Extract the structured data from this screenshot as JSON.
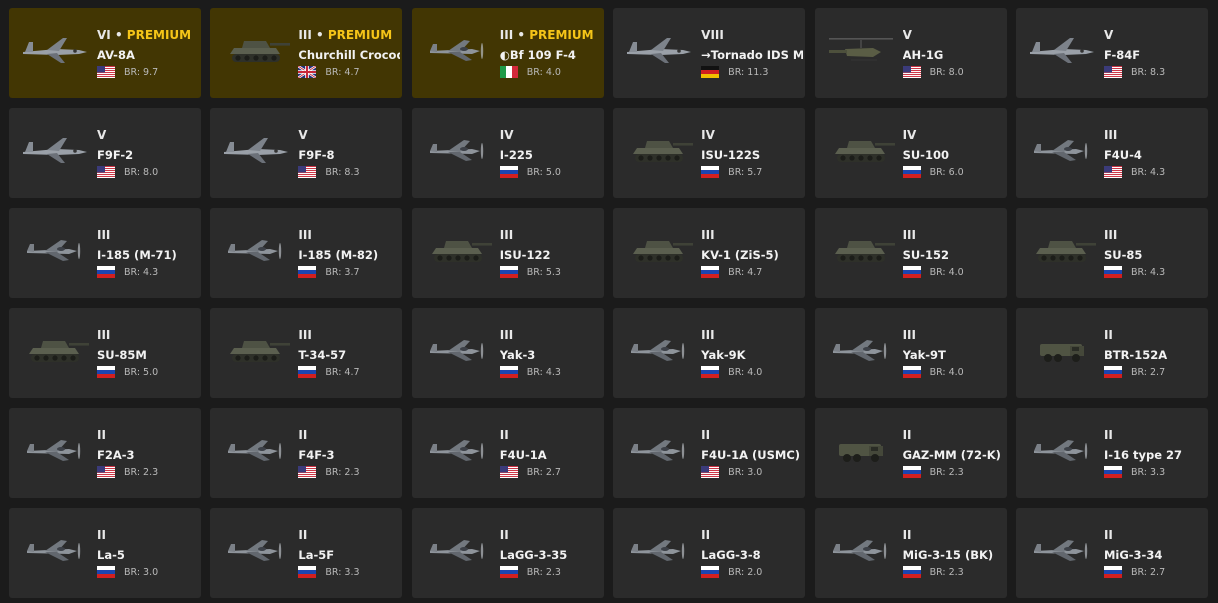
{
  "colors": {
    "background": "#1b1b1b",
    "card": "#2b2b2b",
    "premium_card": "#423603",
    "premium_text": "#f5c518"
  },
  "vehicles": [
    {
      "rank": "VI",
      "premium": true,
      "premium_label": "PREMIUM",
      "name": "AV-8A",
      "flag": "usa",
      "br": "BR: 9.7",
      "type": "jet"
    },
    {
      "rank": "III",
      "premium": true,
      "premium_label": "PREMIUM",
      "name": "Churchill Crocodile",
      "flag": "uk",
      "br": "BR: 4.7",
      "type": "tank"
    },
    {
      "rank": "III",
      "premium": true,
      "premium_label": "PREMIUM",
      "name": "◐Bf 109 F-4",
      "flag": "italy",
      "br": "BR: 4.0",
      "type": "prop"
    },
    {
      "rank": "VIII",
      "premium": false,
      "name": "→Tornado IDS MFG",
      "flag": "germany",
      "br": "BR: 11.3",
      "type": "jet"
    },
    {
      "rank": "V",
      "premium": false,
      "name": "AH-1G",
      "flag": "usa",
      "br": "BR: 8.0",
      "type": "heli"
    },
    {
      "rank": "V",
      "premium": false,
      "name": "F-84F",
      "flag": "usa",
      "br": "BR: 8.3",
      "type": "jet"
    },
    {
      "rank": "V",
      "premium": false,
      "name": "F9F-2",
      "flag": "usa",
      "br": "BR: 8.0",
      "type": "jet"
    },
    {
      "rank": "V",
      "premium": false,
      "name": "F9F-8",
      "flag": "usa",
      "br": "BR: 8.3",
      "type": "jet"
    },
    {
      "rank": "IV",
      "premium": false,
      "name": "I-225",
      "flag": "russia",
      "br": "BR: 5.0",
      "type": "prop"
    },
    {
      "rank": "IV",
      "premium": false,
      "name": "ISU-122S",
      "flag": "russia",
      "br": "BR: 5.7",
      "type": "tank"
    },
    {
      "rank": "IV",
      "premium": false,
      "name": "SU-100",
      "flag": "russia",
      "br": "BR: 6.0",
      "type": "tank"
    },
    {
      "rank": "III",
      "premium": false,
      "name": "F4U-4",
      "flag": "usa",
      "br": "BR: 4.3",
      "type": "prop"
    },
    {
      "rank": "III",
      "premium": false,
      "name": "I-185 (M-71)",
      "flag": "russia",
      "br": "BR: 4.3",
      "type": "prop"
    },
    {
      "rank": "III",
      "premium": false,
      "name": "I-185 (M-82)",
      "flag": "russia",
      "br": "BR: 3.7",
      "type": "prop"
    },
    {
      "rank": "III",
      "premium": false,
      "name": "ISU-122",
      "flag": "russia",
      "br": "BR: 5.3",
      "type": "tank"
    },
    {
      "rank": "III",
      "premium": false,
      "name": "KV-1 (ZiS-5)",
      "flag": "russia",
      "br": "BR: 4.7",
      "type": "tank"
    },
    {
      "rank": "III",
      "premium": false,
      "name": "SU-152",
      "flag": "russia",
      "br": "BR: 4.0",
      "type": "tank"
    },
    {
      "rank": "III",
      "premium": false,
      "name": "SU-85",
      "flag": "russia",
      "br": "BR: 4.3",
      "type": "tank"
    },
    {
      "rank": "III",
      "premium": false,
      "name": "SU-85M",
      "flag": "russia",
      "br": "BR: 5.0",
      "type": "tank"
    },
    {
      "rank": "III",
      "premium": false,
      "name": "T-34-57",
      "flag": "russia",
      "br": "BR: 4.7",
      "type": "tank"
    },
    {
      "rank": "III",
      "premium": false,
      "name": "Yak-3",
      "flag": "russia",
      "br": "BR: 4.3",
      "type": "prop"
    },
    {
      "rank": "III",
      "premium": false,
      "name": "Yak-9K",
      "flag": "russia",
      "br": "BR: 4.0",
      "type": "prop"
    },
    {
      "rank": "III",
      "premium": false,
      "name": "Yak-9T",
      "flag": "russia",
      "br": "BR: 4.0",
      "type": "prop"
    },
    {
      "rank": "II",
      "premium": false,
      "name": "BTR-152A",
      "flag": "russia",
      "br": "BR: 2.7",
      "type": "truck"
    },
    {
      "rank": "II",
      "premium": false,
      "name": "F2A-3",
      "flag": "usa",
      "br": "BR: 2.3",
      "type": "prop"
    },
    {
      "rank": "II",
      "premium": false,
      "name": "F4F-3",
      "flag": "usa",
      "br": "BR: 2.3",
      "type": "prop"
    },
    {
      "rank": "II",
      "premium": false,
      "name": "F4U-1A",
      "flag": "usa",
      "br": "BR: 2.7",
      "type": "prop"
    },
    {
      "rank": "II",
      "premium": false,
      "name": "F4U-1A (USMC)",
      "flag": "usa",
      "br": "BR: 3.0",
      "type": "prop"
    },
    {
      "rank": "II",
      "premium": false,
      "name": "GAZ-MM (72-K)",
      "flag": "russia",
      "br": "BR: 2.3",
      "type": "truck"
    },
    {
      "rank": "II",
      "premium": false,
      "name": "I-16 type 27",
      "flag": "russia",
      "br": "BR: 3.3",
      "type": "prop"
    },
    {
      "rank": "II",
      "premium": false,
      "name": "La-5",
      "flag": "russia",
      "br": "BR: 3.0",
      "type": "prop"
    },
    {
      "rank": "II",
      "premium": false,
      "name": "La-5F",
      "flag": "russia",
      "br": "BR: 3.3",
      "type": "prop"
    },
    {
      "rank": "II",
      "premium": false,
      "name": "LaGG-3-35",
      "flag": "russia",
      "br": "BR: 2.3",
      "type": "prop"
    },
    {
      "rank": "II",
      "premium": false,
      "name": "LaGG-3-8",
      "flag": "russia",
      "br": "BR: 2.0",
      "type": "prop"
    },
    {
      "rank": "II",
      "premium": false,
      "name": "MiG-3-15 (BK)",
      "flag": "russia",
      "br": "BR: 2.3",
      "type": "prop"
    },
    {
      "rank": "II",
      "premium": false,
      "name": "MiG-3-34",
      "flag": "russia",
      "br": "BR: 2.7",
      "type": "prop"
    }
  ]
}
